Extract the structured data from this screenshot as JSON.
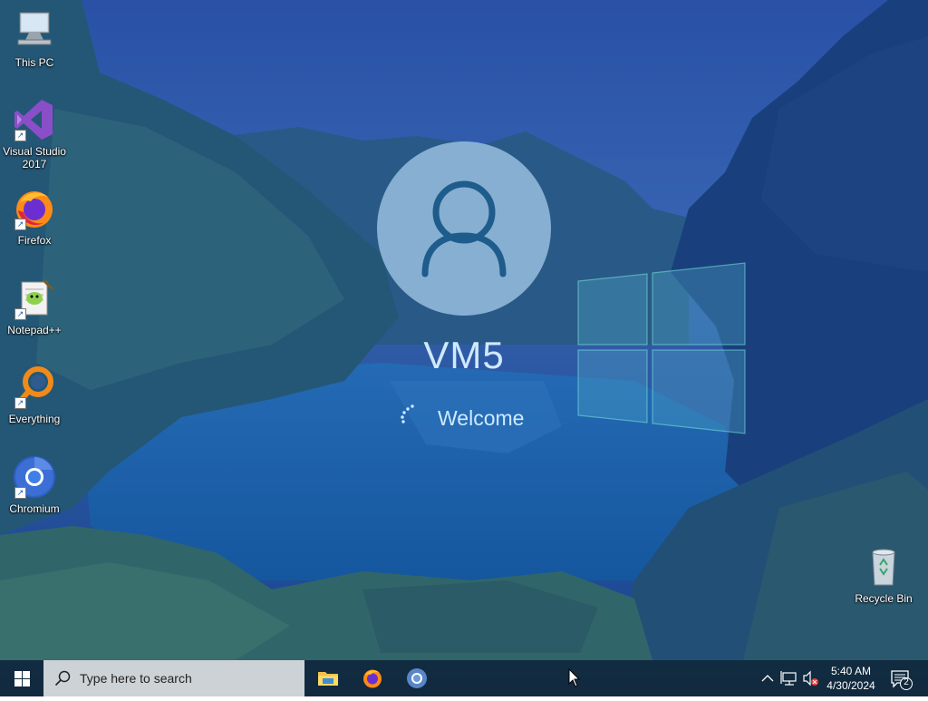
{
  "desktop": {
    "icons": [
      {
        "label": "This PC",
        "icon": "computer-icon",
        "shortcut": false
      },
      {
        "label": "Visual Studio 2017",
        "icon": "visual-studio-icon",
        "shortcut": true
      },
      {
        "label": "Firefox",
        "icon": "firefox-icon",
        "shortcut": true
      },
      {
        "label": "Notepad++",
        "icon": "notepad-plus-plus-icon",
        "shortcut": true
      },
      {
        "label": "Everything",
        "icon": "everything-search-icon",
        "shortcut": true
      },
      {
        "label": "Chromium",
        "icon": "chromium-icon",
        "shortcut": true
      }
    ],
    "recycle_bin": {
      "label": "Recycle Bin",
      "icon": "recycle-bin-icon"
    }
  },
  "login": {
    "username": "VM5",
    "status": "Welcome",
    "avatar_icon": "user-icon",
    "spinner_icon": "loading-spinner-icon"
  },
  "taskbar": {
    "start_icon": "windows-start-icon",
    "search_placeholder": "Type here to search",
    "pinned": [
      "file-explorer-icon",
      "firefox-icon",
      "chromium-icon"
    ],
    "tray_icons": [
      "chevron-up-icon",
      "network-icon",
      "volume-muted-icon"
    ],
    "clock_time": "5:40 AM",
    "clock_date": "4/30/2024",
    "notification_count": "2"
  },
  "colors": {
    "taskbar": "#10283a",
    "search_box": "#cdd2d6",
    "welcome_text": "#cfe9ff",
    "avatar_circle": "#a0c8e6"
  }
}
